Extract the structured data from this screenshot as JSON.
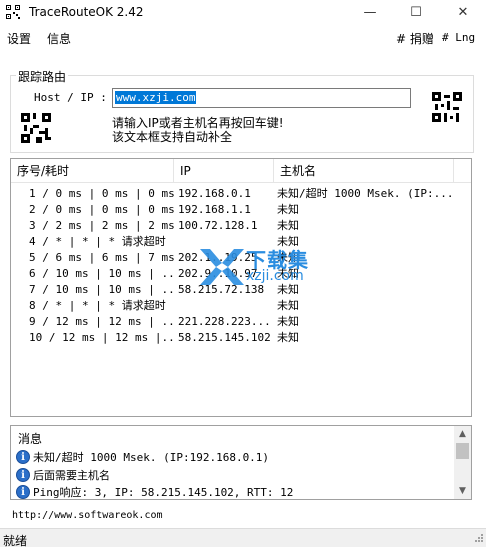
{
  "window": {
    "title": "TraceRouteOK 2.42",
    "minimize": "—",
    "maximize": "☐",
    "close": "✕"
  },
  "menu": {
    "settings": "设置",
    "info": "信息",
    "donate": "# 捐赠",
    "lng": "# Lng"
  },
  "trace": {
    "group_label": "跟踪路由",
    "host_label": "Host / IP :",
    "host_value": "www.xzji.com",
    "hint_line1": "请输入IP或者主机名再按回车键!",
    "hint_line2": "该文本框支持自动补全"
  },
  "table": {
    "headers": [
      "序号/耗时",
      "IP",
      "主机名"
    ],
    "rows": [
      {
        "hop": "1 / 0 ms | 0 ms | 0 ms",
        "ip": "192.168.0.1",
        "host": "未知/超时 1000 Msek. (IP:..."
      },
      {
        "hop": "2 / 0 ms | 0 ms | 0 ms",
        "ip": "192.168.1.1",
        "host": "未知"
      },
      {
        "hop": "3 / 2 ms | 2 ms | 2 ms",
        "ip": "100.72.128.1",
        "host": "未知"
      },
      {
        "hop": "4 / * | * | * 请求超时",
        "ip": "",
        "host": "未知"
      },
      {
        "hop": "5 / 6 ms | 6 ms | 7 ms",
        "ip": "202.1..19.25",
        "host": "未知"
      },
      {
        "hop": "6 / 10 ms | 10 ms | ...",
        "ip": "202.9..10.97",
        "host": "未知"
      },
      {
        "hop": "7 / 10 ms | 10 ms | ...",
        "ip": "58.215.72.138",
        "host": "未知"
      },
      {
        "hop": "8 / * | * | * 请求超时",
        "ip": "",
        "host": "未知"
      },
      {
        "hop": "9 / 12 ms | 12 ms | ...",
        "ip": "221.228.223....",
        "host": "未知"
      },
      {
        "hop": "10 / 12 ms | 12 ms |...",
        "ip": "58.215.145.102",
        "host": "未知"
      }
    ]
  },
  "watermark": {
    "title": "下载集",
    "domain": "xzji.com"
  },
  "messages": {
    "title": "消息",
    "items": [
      "未知/超时 1000 Msek. (IP:192.168.0.1)",
      "后面需要主机名",
      "Ping响应: 3, IP: 58.215.145.102, RTT: 12"
    ]
  },
  "footer": {
    "url": "http://www.softwareok.com",
    "status": "就绪"
  },
  "colors": {
    "selection": "#0078d7",
    "info_icon": "#2b6fc9",
    "watermark": "#2a8de0"
  }
}
